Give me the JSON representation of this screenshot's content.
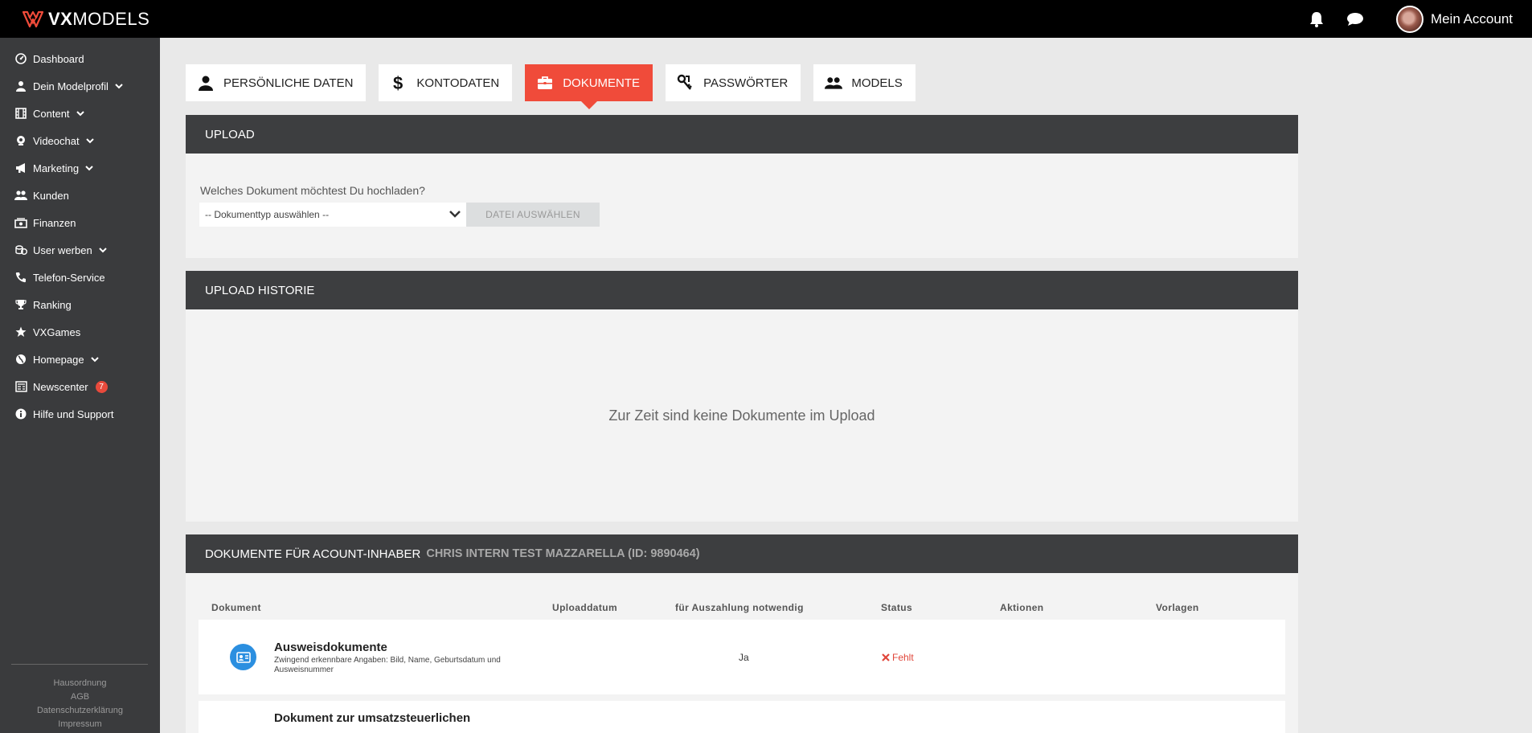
{
  "header": {
    "logo_bold": "VX",
    "logo_light": "MODELS",
    "account_label": "Mein Account"
  },
  "sidebar": {
    "items": [
      {
        "label": "Dashboard",
        "icon": "dashboard-icon",
        "dropdown": false
      },
      {
        "label": "Dein Modelprofil",
        "icon": "user-icon",
        "dropdown": true
      },
      {
        "label": "Content",
        "icon": "film-icon",
        "dropdown": true
      },
      {
        "label": "Videochat",
        "icon": "webcam-icon",
        "dropdown": true
      },
      {
        "label": "Marketing",
        "icon": "megaphone-icon",
        "dropdown": true
      },
      {
        "label": "Kunden",
        "icon": "users-icon",
        "dropdown": false
      },
      {
        "label": "Finanzen",
        "icon": "money-icon",
        "dropdown": false
      },
      {
        "label": "User werben",
        "icon": "coins-icon",
        "dropdown": true
      },
      {
        "label": "Telefon-Service",
        "icon": "phone-icon",
        "dropdown": false
      },
      {
        "label": "Ranking",
        "icon": "trophy-icon",
        "dropdown": false
      },
      {
        "label": "VXGames",
        "icon": "star-icon",
        "dropdown": false
      },
      {
        "label": "Homepage",
        "icon": "globe-icon",
        "dropdown": true
      },
      {
        "label": "Newscenter",
        "icon": "newspaper-icon",
        "dropdown": false,
        "badge": "7"
      },
      {
        "label": "Hilfe und Support",
        "icon": "info-icon",
        "dropdown": false
      }
    ],
    "footer_links": [
      "Hausordnung",
      "AGB",
      "Datenschutzerklärung",
      "Impressum"
    ]
  },
  "tabs": [
    {
      "label": "PERSÖNLICHE DATEN",
      "icon": "user-icon",
      "active": false
    },
    {
      "label": "KONTODATEN",
      "icon": "dollar-icon",
      "active": false
    },
    {
      "label": "DOKUMENTE",
      "icon": "briefcase-icon",
      "active": true
    },
    {
      "label": "PASSWÖRTER",
      "icon": "keys-icon",
      "active": false
    },
    {
      "label": "MODELS",
      "icon": "group-icon",
      "active": false
    }
  ],
  "upload": {
    "title": "UPLOAD",
    "question": "Welches Dokument möchtest Du hochladen?",
    "select_value": "-- Dokumenttyp auswählen --",
    "file_button": "DATEI AUSWÄHLEN"
  },
  "history": {
    "title": "UPLOAD HISTORIE",
    "empty_message": "Zur Zeit sind keine Dokumente im Upload"
  },
  "documents": {
    "title": "DOKUMENTE FÜR ACOUNT-INHABER",
    "owner": "CHRIS INTERN TEST MAZZARELLA (ID: 9890464)",
    "columns": [
      "Dokument",
      "Uploaddatum",
      "für Auszahlung notwendig",
      "Status",
      "Aktionen",
      "Vorlagen"
    ],
    "rows": [
      {
        "title": "Ausweisdokumente",
        "description": "Zwingend erkennbare Angaben: Bild, Name, Geburtsdatum und Ausweisnummer",
        "required": "Ja",
        "status": "Fehlt"
      },
      {
        "title": "Dokument zur umsatzsteuerlichen"
      }
    ]
  },
  "colors": {
    "accent": "#f04b3a",
    "header_bg": "#000000",
    "sidebar_bg": "#3a3b3d",
    "panel_head_bg": "#3d3e40",
    "doc_icon": "#2b8fe0",
    "status_missing": "#e0463a"
  }
}
